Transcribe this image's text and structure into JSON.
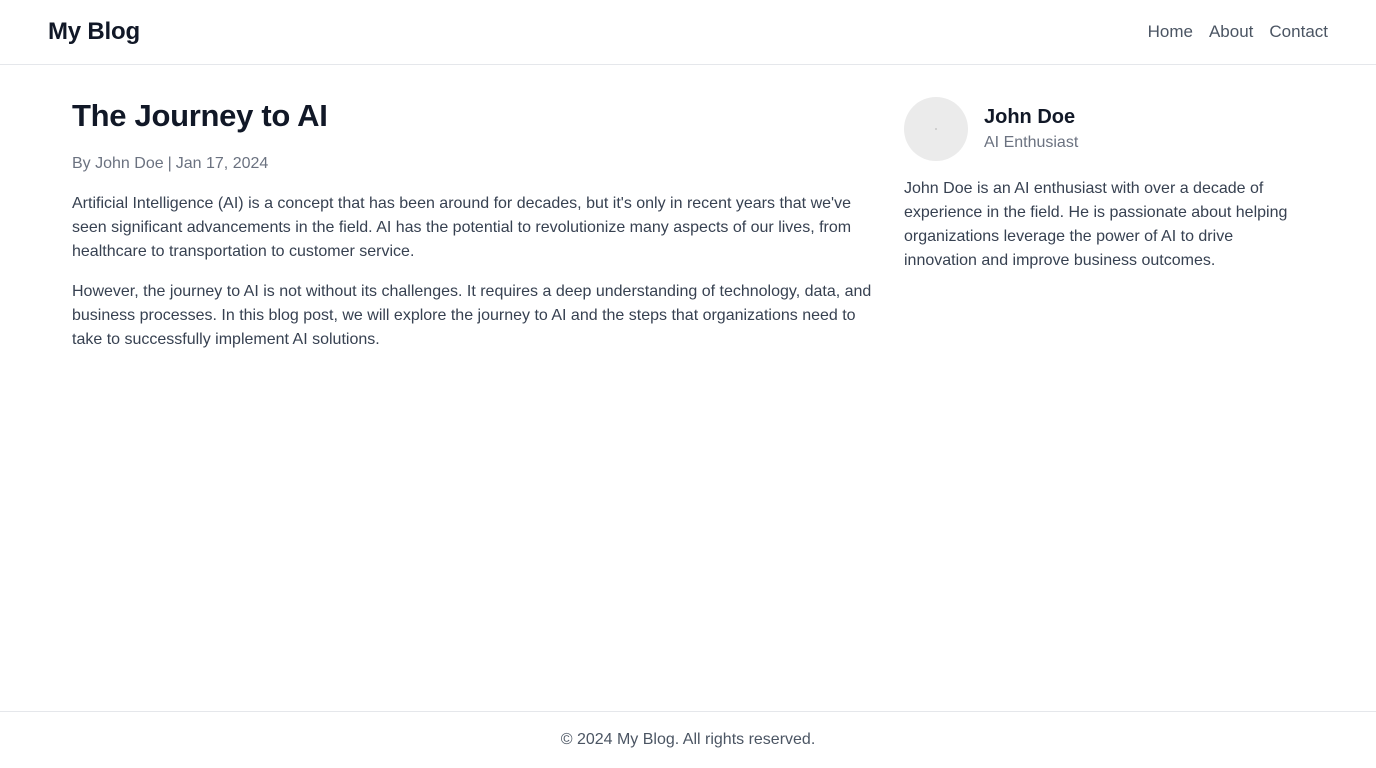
{
  "header": {
    "site_title": "My Blog",
    "nav": {
      "home": "Home",
      "about": "About",
      "contact": "Contact"
    }
  },
  "post": {
    "title": "The Journey to AI",
    "meta": {
      "byline": "By John Doe",
      "separator": "|",
      "date": "Jan 17, 2024"
    },
    "paragraphs": [
      "Artificial Intelligence (AI) is a concept that has been around for decades, but it's only in recent years that we've seen significant advancements in the field. AI has the potential to revolutionize many aspects of our lives, from healthcare to transportation to customer service.",
      "However, the journey to AI is not without its challenges. It requires a deep understanding of technology, data, and business processes. In this blog post, we will explore the journey to AI and the steps that organizations need to take to successfully implement AI solutions."
    ]
  },
  "author": {
    "name": "John Doe",
    "role": "AI Enthusiast",
    "bio": "John Doe is an AI enthusiast with over a decade of experience in the field. He is passionate about helping organizations leverage the power of AI to drive innovation and improve business outcomes."
  },
  "footer": {
    "copyright": "© 2024 My Blog. All rights reserved."
  }
}
